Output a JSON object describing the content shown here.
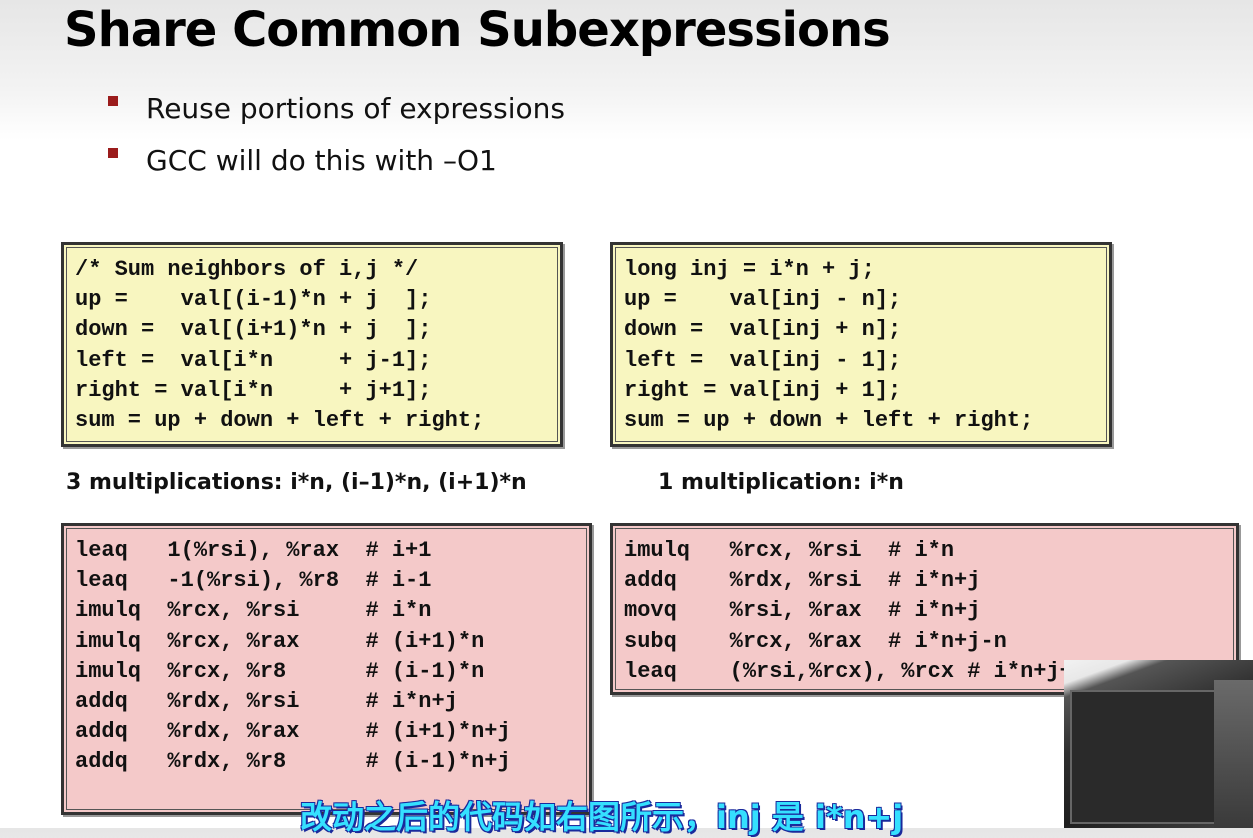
{
  "title": "Share Common Subexpressions",
  "bullets": [
    "Reuse portions of expressions",
    "GCC will do this with –O1"
  ],
  "code_before": "/* Sum neighbors of i,j */\nup =    val[(i-1)*n + j  ];\ndown =  val[(i+1)*n + j  ];\nleft =  val[i*n     + j-1];\nright = val[i*n     + j+1];\nsum = up + down + left + right;",
  "code_after": "long inj = i*n + j;\nup =    val[inj - n];\ndown =  val[inj + n];\nleft =  val[inj - 1];\nright = val[inj + 1];\nsum = up + down + left + right;",
  "caption_left": "3 multiplications: i*n, (i–1)*n, (i+1)*n",
  "caption_right": "1 multiplication: i*n",
  "asm_before": "leaq   1(%rsi), %rax  # i+1\nleaq   -1(%rsi), %r8  # i-1\nimulq  %rcx, %rsi     # i*n\nimulq  %rcx, %rax     # (i+1)*n\nimulq  %rcx, %r8      # (i-1)*n\naddq   %rdx, %rsi     # i*n+j\naddq   %rdx, %rax     # (i+1)*n+j\naddq   %rdx, %r8      # (i-1)*n+j",
  "asm_after": "imulq   %rcx, %rsi  # i*n\naddq    %rdx, %rsi  # i*n+j\nmovq    %rsi, %rax  # i*n+j\nsubq    %rcx, %rax  # i*n+j-n\nleaq    (%rsi,%rcx), %rcx # i*n+j+n",
  "subtitle": "改动之后的代码如右图所示，inj 是 i*n+j",
  "colors": {
    "code_box": "#f8f6c0",
    "asm_box": "#f4c9c9",
    "bullet": "#9b1c1c",
    "subtitle": "#35e0ff"
  }
}
